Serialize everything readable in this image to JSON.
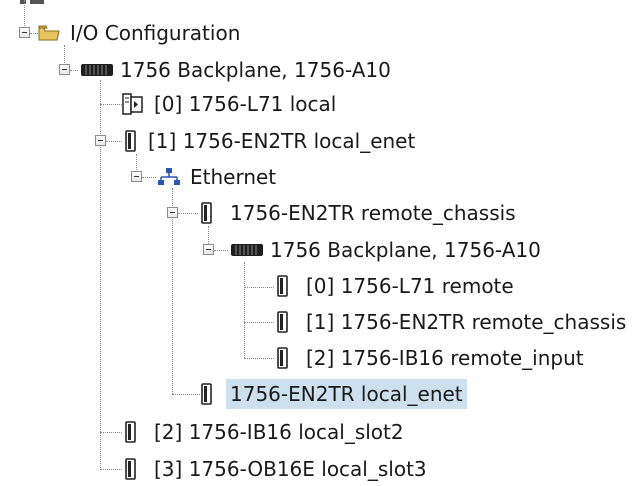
{
  "tree": {
    "root": {
      "label": "I/O Configuration",
      "icon": "folder-icon",
      "expanded": true
    },
    "backplane": {
      "label": "1756 Backplane, 1756-A10",
      "icon": "backplane-chassis-icon",
      "expanded": true
    },
    "slot0": {
      "label": "[0] 1756-L71 local",
      "icon": "controller-module-icon"
    },
    "slot1": {
      "label": "[1] 1756-EN2TR local_enet",
      "icon": "io-module-icon",
      "expanded": true
    },
    "ethernet": {
      "label": "Ethernet",
      "icon": "network-icon",
      "expanded": true
    },
    "remote_adapter": {
      "label": "1756-EN2TR remote_chassis",
      "icon": "io-module-icon",
      "expanded": true
    },
    "remote_backplane": {
      "label": "1756 Backplane, 1756-A10",
      "icon": "backplane-chassis-icon",
      "expanded": true
    },
    "remote_slot0": {
      "label": "[0] 1756-L71 remote",
      "icon": "io-module-icon"
    },
    "remote_slot1": {
      "label": "[1] 1756-EN2TR remote_chassis",
      "icon": "io-module-icon"
    },
    "remote_slot2": {
      "label": "[2] 1756-IB16 remote_input",
      "icon": "io-module-icon"
    },
    "local_enet": {
      "label": "1756-EN2TR local_enet",
      "icon": "io-module-icon",
      "selected": true
    },
    "slot2": {
      "label": "[2] 1756-IB16 local_slot2",
      "icon": "io-module-icon"
    },
    "slot3": {
      "label": "[3] 1756-OB16E local_slot3",
      "icon": "io-module-icon"
    }
  },
  "colors": {
    "selection": "#cde0ee",
    "connector": "#8a8a8a"
  }
}
